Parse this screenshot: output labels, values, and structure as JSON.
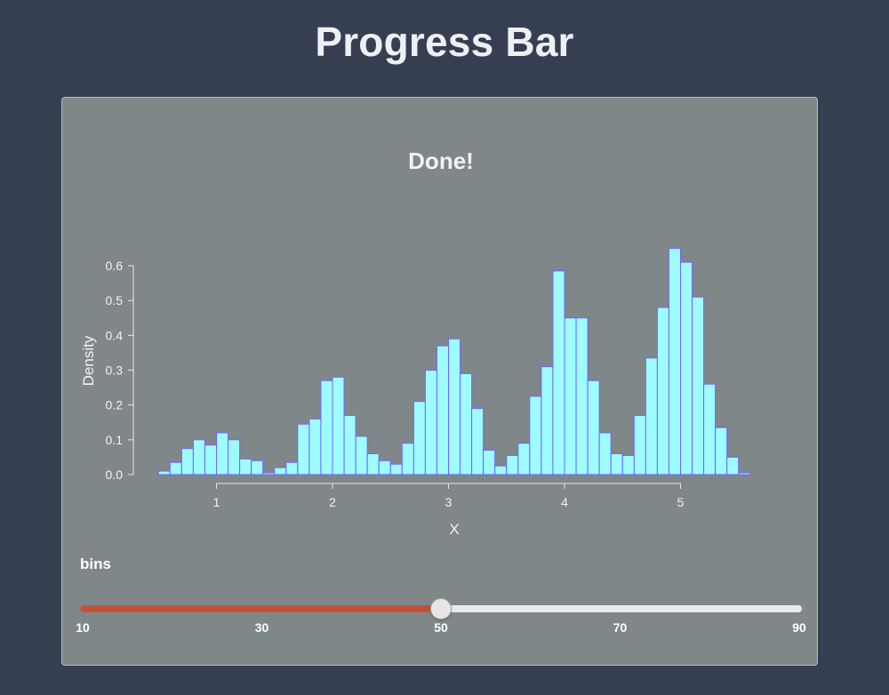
{
  "page": {
    "title": "Progress Bar"
  },
  "colors": {
    "background": "#363f52",
    "panel": "#808789",
    "bar_fill": "#9efcff",
    "bar_stroke": "#6f63ff",
    "slider_fill": "#c3513a",
    "slider_track": "#e9e9e9",
    "text": "#ffffff"
  },
  "chart_data": {
    "type": "bar",
    "title": "Done!",
    "xlabel": "X",
    "ylabel": "Density",
    "xlim": [
      0.5,
      5.6
    ],
    "ylim": [
      0,
      0.6
    ],
    "xticks": [
      1,
      2,
      3,
      4,
      5
    ],
    "yticks": [
      "0.0",
      "0.1",
      "0.2",
      "0.3",
      "0.4",
      "0.5",
      "0.6"
    ],
    "grid": false,
    "bin_width": 0.1,
    "bin_starts": [
      0.5,
      0.6,
      0.7,
      0.8,
      0.9,
      1.0,
      1.1,
      1.2,
      1.3,
      1.4,
      1.5,
      1.6,
      1.7,
      1.8,
      1.9,
      2.0,
      2.1,
      2.2,
      2.3,
      2.4,
      2.5,
      2.6,
      2.7,
      2.8,
      2.9,
      3.0,
      3.1,
      3.2,
      3.3,
      3.4,
      3.5,
      3.6,
      3.7,
      3.8,
      3.9,
      4.0,
      4.1,
      4.2,
      4.3,
      4.4,
      4.5,
      4.6,
      4.7,
      4.8,
      4.9,
      5.0,
      5.1,
      5.2,
      5.3,
      5.4,
      5.5
    ],
    "values": [
      0.01,
      0.035,
      0.075,
      0.1,
      0.085,
      0.12,
      0.1,
      0.045,
      0.04,
      0.005,
      0.02,
      0.035,
      0.145,
      0.16,
      0.27,
      0.28,
      0.17,
      0.11,
      0.06,
      0.04,
      0.03,
      0.09,
      0.21,
      0.3,
      0.37,
      0.39,
      0.29,
      0.19,
      0.07,
      0.025,
      0.055,
      0.09,
      0.225,
      0.31,
      0.585,
      0.45,
      0.45,
      0.27,
      0.12,
      0.06,
      0.055,
      0.17,
      0.335,
      0.48,
      0.65,
      0.61,
      0.51,
      0.26,
      0.135,
      0.05,
      0.005
    ]
  },
  "slider": {
    "label": "bins",
    "min": 10,
    "max": 90,
    "value": 50,
    "ticks": [
      "10",
      "30",
      "50",
      "70",
      "90"
    ]
  }
}
